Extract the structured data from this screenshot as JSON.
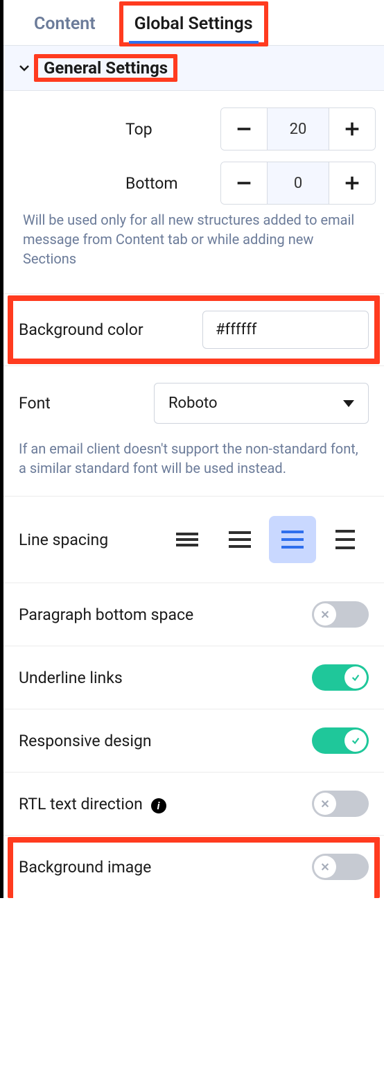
{
  "tabs": {
    "content": "Content",
    "global": "Global Settings"
  },
  "section": {
    "general": "General Settings"
  },
  "margins": {
    "top_label": "Top",
    "top_value": "20",
    "bottom_label": "Bottom",
    "bottom_value": "0",
    "hint": "Will be used only for all new structures added to email message from Content tab or while adding new Sections"
  },
  "background_color": {
    "label": "Background color",
    "value": "#ffffff"
  },
  "font": {
    "label": "Font",
    "value": "Roboto",
    "hint": "If an email client doesn't support the non-standard font, a similar standard font will be used instead."
  },
  "line_spacing": {
    "label": "Line spacing"
  },
  "toggles": {
    "paragraph_bottom_space": {
      "label": "Paragraph bottom space",
      "value": false
    },
    "underline_links": {
      "label": "Underline links",
      "value": true
    },
    "responsive_design": {
      "label": "Responsive design",
      "value": true
    },
    "rtl_text_direction": {
      "label": "RTL text direction",
      "value": false
    },
    "background_image": {
      "label": "Background image",
      "value": false
    }
  }
}
